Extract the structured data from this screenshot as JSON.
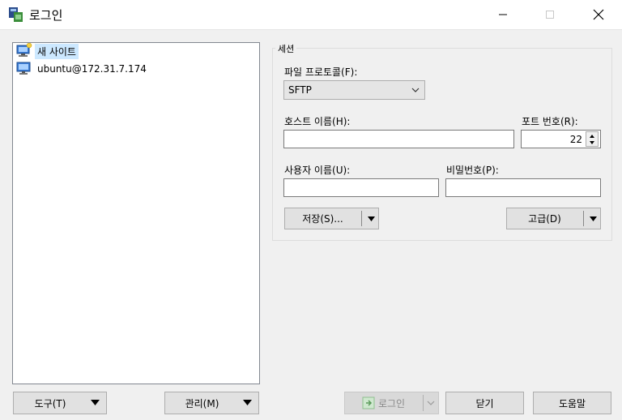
{
  "window": {
    "title": "로그인",
    "minimize_icon": "minimize-icon",
    "maximize_icon": "maximize-icon",
    "close_icon": "close-icon"
  },
  "site_tree": {
    "items": [
      {
        "label": "새 사이트",
        "icon": "new-site-computer-icon",
        "selected": true
      },
      {
        "label": "ubuntu@172.31.7.174",
        "icon": "computer-icon",
        "selected": false
      }
    ]
  },
  "session": {
    "group_title": "세션",
    "protocol_label": "파일 프로토콜(F):",
    "protocol_value": "SFTP",
    "host_label": "호스트 이름(H):",
    "host_value": "",
    "port_label": "포트 번호(R):",
    "port_value": "22",
    "user_label": "사용자 이름(U):",
    "user_value": "",
    "password_label": "비밀번호(P):",
    "password_value": "",
    "save_label": "저장(S)...",
    "advanced_label": "고급(D)"
  },
  "footer": {
    "tools_label": "도구(T)",
    "manage_label": "관리(M)",
    "login_label": "로그인",
    "close_label": "닫기",
    "help_label": "도움말"
  },
  "colors": {
    "selection": "#cce8ff",
    "button_face": "#e1e1e1",
    "window_bg": "#f0f0f0"
  }
}
